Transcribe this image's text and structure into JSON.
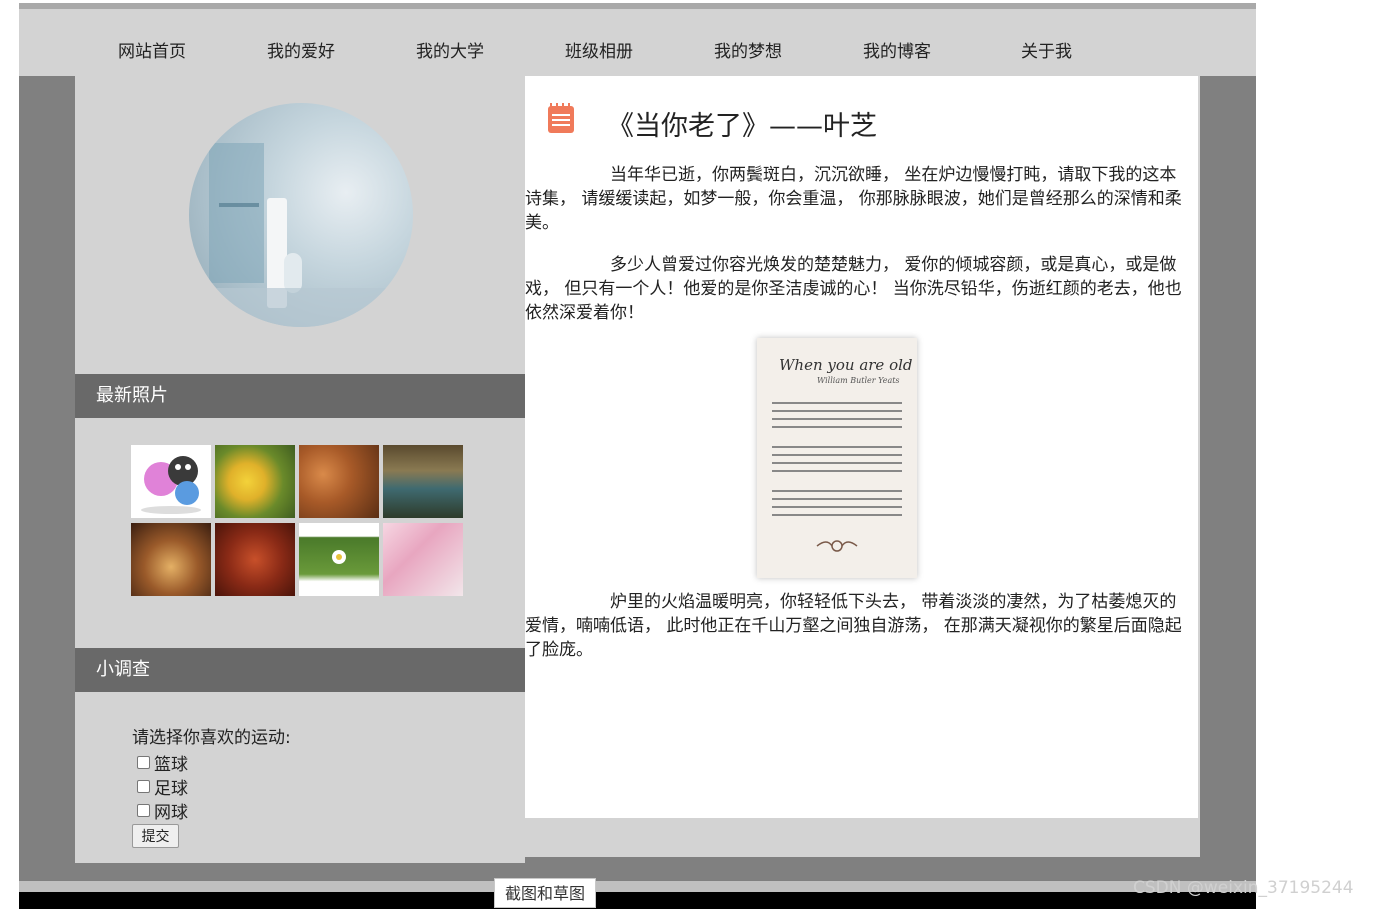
{
  "nav": {
    "items": [
      "网站首页",
      "我的爱好",
      "我的大学",
      "班级相册",
      "我的梦想",
      "我的博客",
      "关于我"
    ]
  },
  "sidebar": {
    "photos_heading": "最新照片",
    "survey_heading": "小调查",
    "survey": {
      "question": "请选择你喜欢的运动:",
      "options": [
        "篮球",
        "足球",
        "网球"
      ],
      "submit_label": "提交"
    }
  },
  "article": {
    "title": "《当你老了》——叶芝",
    "paragraphs": [
      "当年华已逝，你两鬓斑白，沉沉欲睡， 坐在炉边慢慢打盹，请取下我的这本诗集， 请缓缓读起，如梦一般，你会重温， 你那脉脉眼波，她们是曾经那么的深情和柔美。",
      "多少人曾爱过你容光焕发的楚楚魅力， 爱你的倾城容颜，或是真心，或是做戏， 但只有一个人！他爱的是你圣洁虔诚的心！ 当你洗尽铅华，伤逝红颜的老去，他也依然深爱着你！",
      "炉里的火焰温暖明亮，你轻轻低下头去， 带着淡淡的凄然，为了枯萎熄灭的爱情，喃喃低语， 此时他正在千山万壑之间独自游荡， 在那满天凝视你的繁星后面隐起了脸庞。"
    ],
    "poem_image": {
      "title": "When you are old",
      "author": "William Butler Yeats"
    }
  },
  "overlay": {
    "tooltip": "截图和草图",
    "watermark": "CSDN @weixin_37195244"
  },
  "colors": {
    "nav_bg": "#d3d3d3",
    "outer_bg": "#808080",
    "section_head_bg": "#696969",
    "icon_accent": "#f07a5a"
  }
}
